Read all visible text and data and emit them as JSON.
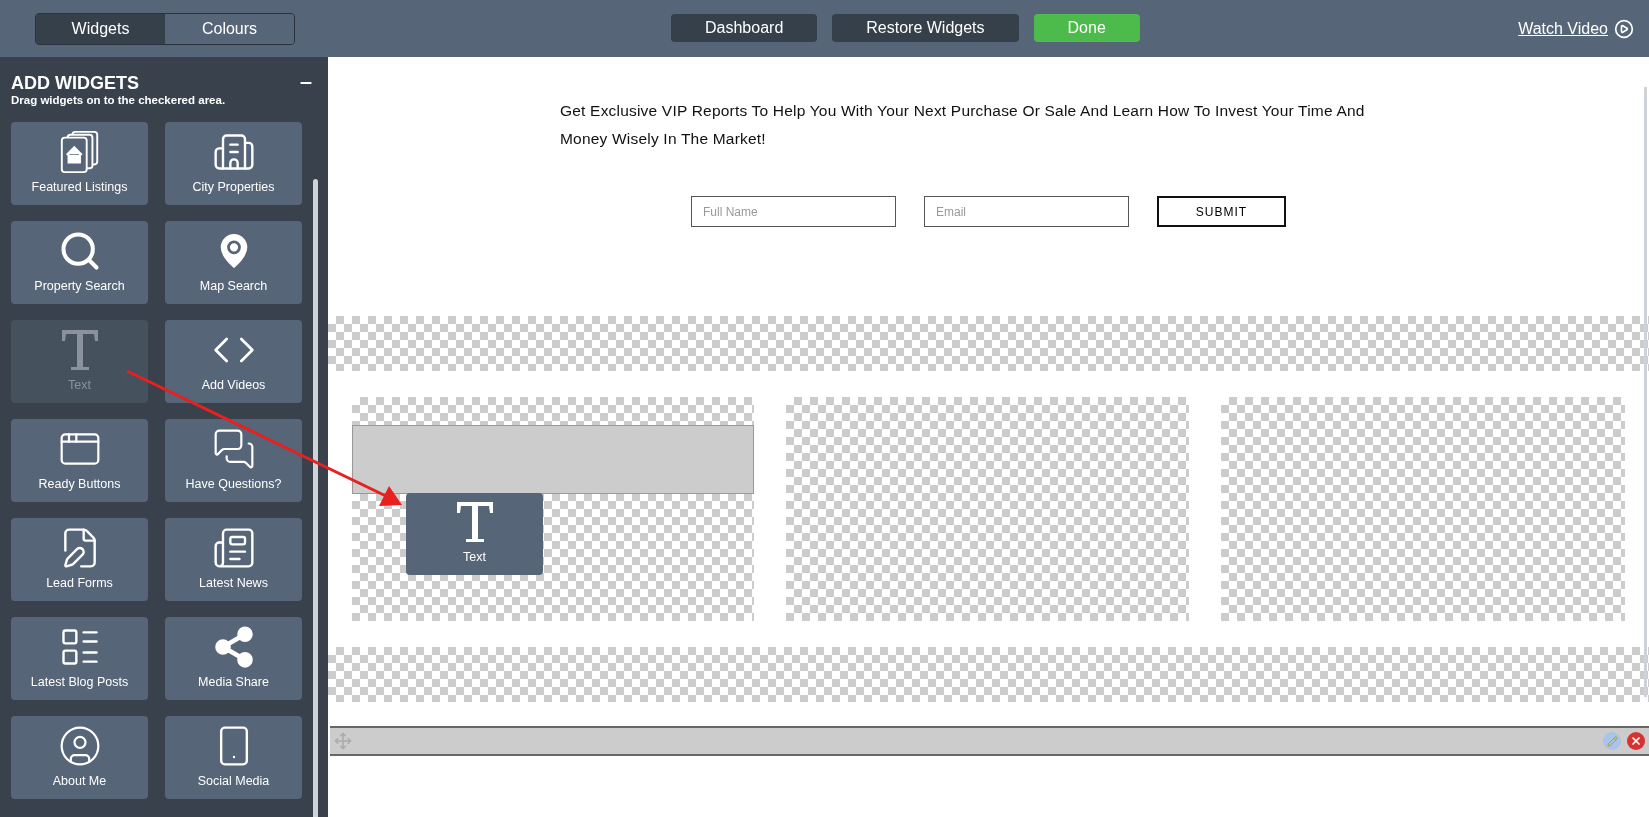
{
  "top_bar": {
    "tabs": [
      {
        "label": "Widgets",
        "selected": true
      },
      {
        "label": "Colours",
        "selected": false
      }
    ],
    "actions": [
      {
        "label": "Dashboard",
        "kind": "dark"
      },
      {
        "label": "Restore Widgets",
        "kind": "dark"
      },
      {
        "label": "Done",
        "kind": "primary"
      }
    ],
    "watch_video": "Watch Video"
  },
  "sidebar": {
    "title": "ADD WIDGETS",
    "subtitle": "Drag widgets on to the checkered area.",
    "widgets": [
      {
        "label": "Featured Listings",
        "disabled": false
      },
      {
        "label": "City Properties",
        "disabled": false
      },
      {
        "label": "Property Search",
        "disabled": false
      },
      {
        "label": "Map Search",
        "disabled": false
      },
      {
        "label": "Text",
        "disabled": true
      },
      {
        "label": "Add Videos",
        "disabled": false
      },
      {
        "label": "Ready Buttons",
        "disabled": false
      },
      {
        "label": "Have Questions?",
        "disabled": false
      },
      {
        "label": "Lead Forms",
        "disabled": false
      },
      {
        "label": "Latest News",
        "disabled": false
      },
      {
        "label": "Latest Blog Posts",
        "disabled": false
      },
      {
        "label": "Media Share",
        "disabled": false
      },
      {
        "label": "About Me",
        "disabled": false
      },
      {
        "label": "Social Media",
        "disabled": false
      }
    ]
  },
  "canvas": {
    "heading": "Get Exclusive VIP Reports To Help You With Your Next Purchase Or Sale And Learn How To Invest Your Time And Money Wisely In The Market!",
    "form": {
      "fields": [
        {
          "placeholder": "Full Name"
        },
        {
          "placeholder": "Email"
        }
      ],
      "submit": "SUBMIT"
    },
    "drag_preview": {
      "label": "Text"
    }
  }
}
